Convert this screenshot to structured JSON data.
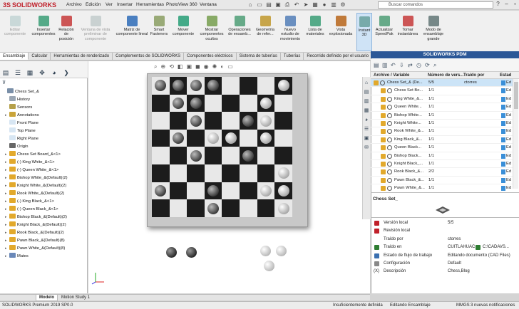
{
  "app": {
    "logo_text": "SOLIDWORKS",
    "logo_mark": "3S"
  },
  "menu": [
    "Archivo",
    "Edición",
    "Ver",
    "Insertar",
    "Herramientas",
    "PhotoView 360",
    "Ventana"
  ],
  "search": {
    "placeholder": "Buscar comandos"
  },
  "ribbon": [
    {
      "label": "Editar\ncomponente",
      "disabled": true
    },
    {
      "label": "Insertar\ncomponentes",
      "disabled": false
    },
    {
      "label": "Relación\nde\nposición",
      "disabled": false
    },
    {
      "label": "Ventana de vista\npreliminar de\ncomponente",
      "disabled": true
    },
    {
      "label": "Matriz de\ncomponente lineal",
      "disabled": false
    },
    {
      "label": "Smart\nFasteners",
      "disabled": false
    },
    {
      "label": "Mover\ncomponente",
      "disabled": false
    },
    {
      "label": "Mostrar\ncomponentes\nocultos",
      "disabled": false
    },
    {
      "label": "Operaciones\nde ensamb...",
      "disabled": false
    },
    {
      "label": "Geometría\nde refer...",
      "disabled": false
    },
    {
      "label": "Nuevo\nestudio de\nmovimiento",
      "disabled": false
    },
    {
      "label": "Lista de\nmateriales",
      "disabled": false
    },
    {
      "label": "Vista\nexplosionada",
      "disabled": false
    },
    {
      "label": "Instant\n3D",
      "disabled": false,
      "active": true
    },
    {
      "label": "Actualizar\nSpeedPak",
      "disabled": false
    },
    {
      "label": "Tomar\ninstantánea",
      "disabled": false
    },
    {
      "label": "Modo de\nensamblaje\ngrande",
      "disabled": false
    }
  ],
  "tabs": [
    "Ensamblaje",
    "Calcular",
    "Herramientas de renderizado",
    "Complementos de SOLIDWORKS",
    "Componentes eléctricos",
    "Sistema de tuberías",
    "Tuberías",
    "Recorrido definido por el usuario"
  ],
  "tree": [
    {
      "label": "Chess Set_&",
      "indent": 0,
      "expand": "",
      "icon": "#7a8fa8"
    },
    {
      "label": "History",
      "indent": 1,
      "expand": "",
      "icon": "#9aa6b4"
    },
    {
      "label": "Sensors",
      "indent": 1,
      "expand": "",
      "icon": "#b5a04a"
    },
    {
      "label": "Annotations",
      "indent": 1,
      "expand": "▸",
      "icon": "#c9a43a"
    },
    {
      "label": "Front Plane",
      "indent": 1,
      "expand": "",
      "icon": "#d7e6f3"
    },
    {
      "label": "Top Plane",
      "indent": 1,
      "expand": "",
      "icon": "#d7e6f3"
    },
    {
      "label": "Right Plane",
      "indent": 1,
      "expand": "",
      "icon": "#d7e6f3"
    },
    {
      "label": "Origin",
      "indent": 1,
      "expand": "",
      "icon": "#666"
    },
    {
      "label": "Chess Set Board_&<1>",
      "indent": 1,
      "expand": "▸",
      "icon": "#e2a92c"
    },
    {
      "label": "(-) King White_&<1>",
      "indent": 1,
      "expand": "▸",
      "icon": "#e2a92c"
    },
    {
      "label": "(-) Queen White_&<1>",
      "indent": 1,
      "expand": "▸",
      "icon": "#e2a92c"
    },
    {
      "label": "Bishop White_&(Default)(2)",
      "indent": 1,
      "expand": "▸",
      "icon": "#e2a92c"
    },
    {
      "label": "Knight White_&(Default)(2)",
      "indent": 1,
      "expand": "▸",
      "icon": "#e2a92c"
    },
    {
      "label": "Rook White_&(Default)(2)",
      "indent": 1,
      "expand": "▸",
      "icon": "#e2a92c"
    },
    {
      "label": "(-) King Black_&<1>",
      "indent": 1,
      "expand": "▸",
      "icon": "#e2a92c"
    },
    {
      "label": "(-) Queen Black_&<1>",
      "indent": 1,
      "expand": "▸",
      "icon": "#e2a92c"
    },
    {
      "label": "Bishop Black_&(Default)(2)",
      "indent": 1,
      "expand": "▸",
      "icon": "#e2a92c"
    },
    {
      "label": "Knight Black_&(Default)(2)",
      "indent": 1,
      "expand": "▸",
      "icon": "#e2a92c"
    },
    {
      "label": "Rook Black_&(Default)(2)",
      "indent": 1,
      "expand": "▸",
      "icon": "#e2a92c"
    },
    {
      "label": "Pawn Black_&(Default)(8)",
      "indent": 1,
      "expand": "▸",
      "icon": "#e2a92c"
    },
    {
      "label": "Pawn White_&(Default)(8)",
      "indent": 1,
      "expand": "▸",
      "icon": "#e2a92c"
    },
    {
      "label": "Mates",
      "indent": 1,
      "expand": "▸",
      "icon": "#6a88b8"
    }
  ],
  "pdm": {
    "title": "SOLIDWORKS PDM",
    "columns": [
      "Archivo / Variable",
      "Número de vers...",
      "Traído por",
      "Estad"
    ],
    "rows": [
      {
        "name": "Chess Set_& (De...",
        "ver": "5/5",
        "by": "ctorres",
        "state": "Ed",
        "sel": true,
        "indent": 0
      },
      {
        "name": "Chess Set Bo...",
        "ver": "1/1",
        "by": "",
        "state": "Ed",
        "sel": false,
        "indent": 1
      },
      {
        "name": "King White_&...",
        "ver": "1/1",
        "by": "",
        "state": "Ed",
        "sel": false,
        "indent": 1
      },
      {
        "name": "Queen White...",
        "ver": "1/1",
        "by": "",
        "state": "Ed",
        "sel": false,
        "indent": 1
      },
      {
        "name": "Bishop White...",
        "ver": "1/1",
        "by": "",
        "state": "Ed",
        "sel": false,
        "indent": 1
      },
      {
        "name": "Knight White...",
        "ver": "1/1",
        "by": "",
        "state": "Ed",
        "sel": false,
        "indent": 1
      },
      {
        "name": "Rook White_&...",
        "ver": "1/1",
        "by": "",
        "state": "Ed",
        "sel": false,
        "indent": 1
      },
      {
        "name": "King Black_&...",
        "ver": "1/1",
        "by": "",
        "state": "Ed",
        "sel": false,
        "indent": 1
      },
      {
        "name": "Queen Black...",
        "ver": "1/1",
        "by": "",
        "state": "Ed",
        "sel": false,
        "indent": 1
      },
      {
        "name": "Bishop Black...",
        "ver": "1/1",
        "by": "",
        "state": "Ed",
        "sel": false,
        "indent": 1
      },
      {
        "name": "Knight Black_...",
        "ver": "1/1",
        "by": "",
        "state": "Ed",
        "sel": false,
        "indent": 1
      },
      {
        "name": "Rook Black_&...",
        "ver": "2/2",
        "by": "",
        "state": "Ed",
        "sel": false,
        "indent": 1
      },
      {
        "name": "Pawn Black_&...",
        "ver": "1/1",
        "by": "",
        "state": "Ed",
        "sel": false,
        "indent": 1
      },
      {
        "name": "Pawn White_&...",
        "ver": "1/1",
        "by": "",
        "state": "Ed",
        "sel": false,
        "indent": 1
      }
    ],
    "preview_title": "Chess Set_",
    "details": [
      {
        "icon": "#c0202a",
        "label": "Versión local",
        "value": "5/5"
      },
      {
        "icon": "#c0202a",
        "label": "Revisión local",
        "value": ""
      },
      {
        "icon": "",
        "label": "Traído por",
        "value": "ctorres"
      },
      {
        "icon": "#2e7d32",
        "label": "Traído en",
        "value": "CUITLAHUAC",
        "value2": "C:\\CADAVS..."
      },
      {
        "icon": "#3a6fb0",
        "label": "Estado de flujo de trabajo",
        "value": "Editando documento (CAD Files)"
      },
      {
        "icon": "#888",
        "label": "Configuración",
        "value": "Default"
      },
      {
        "icon": "#555",
        "label": "Descripción",
        "value": "Chess,Blog",
        "prefix": "(X)"
      }
    ]
  },
  "bottom_tabs": [
    "",
    "Modelo",
    "Motion Study 1"
  ],
  "status": {
    "left": "SOLIDWORKS Premium 2019 SP0.0",
    "mid1": "Insuficientemente definida",
    "mid2": "Editando Ensamblaje",
    "unit": "MMGS",
    "notif": "3 nuevas notificaciones"
  }
}
